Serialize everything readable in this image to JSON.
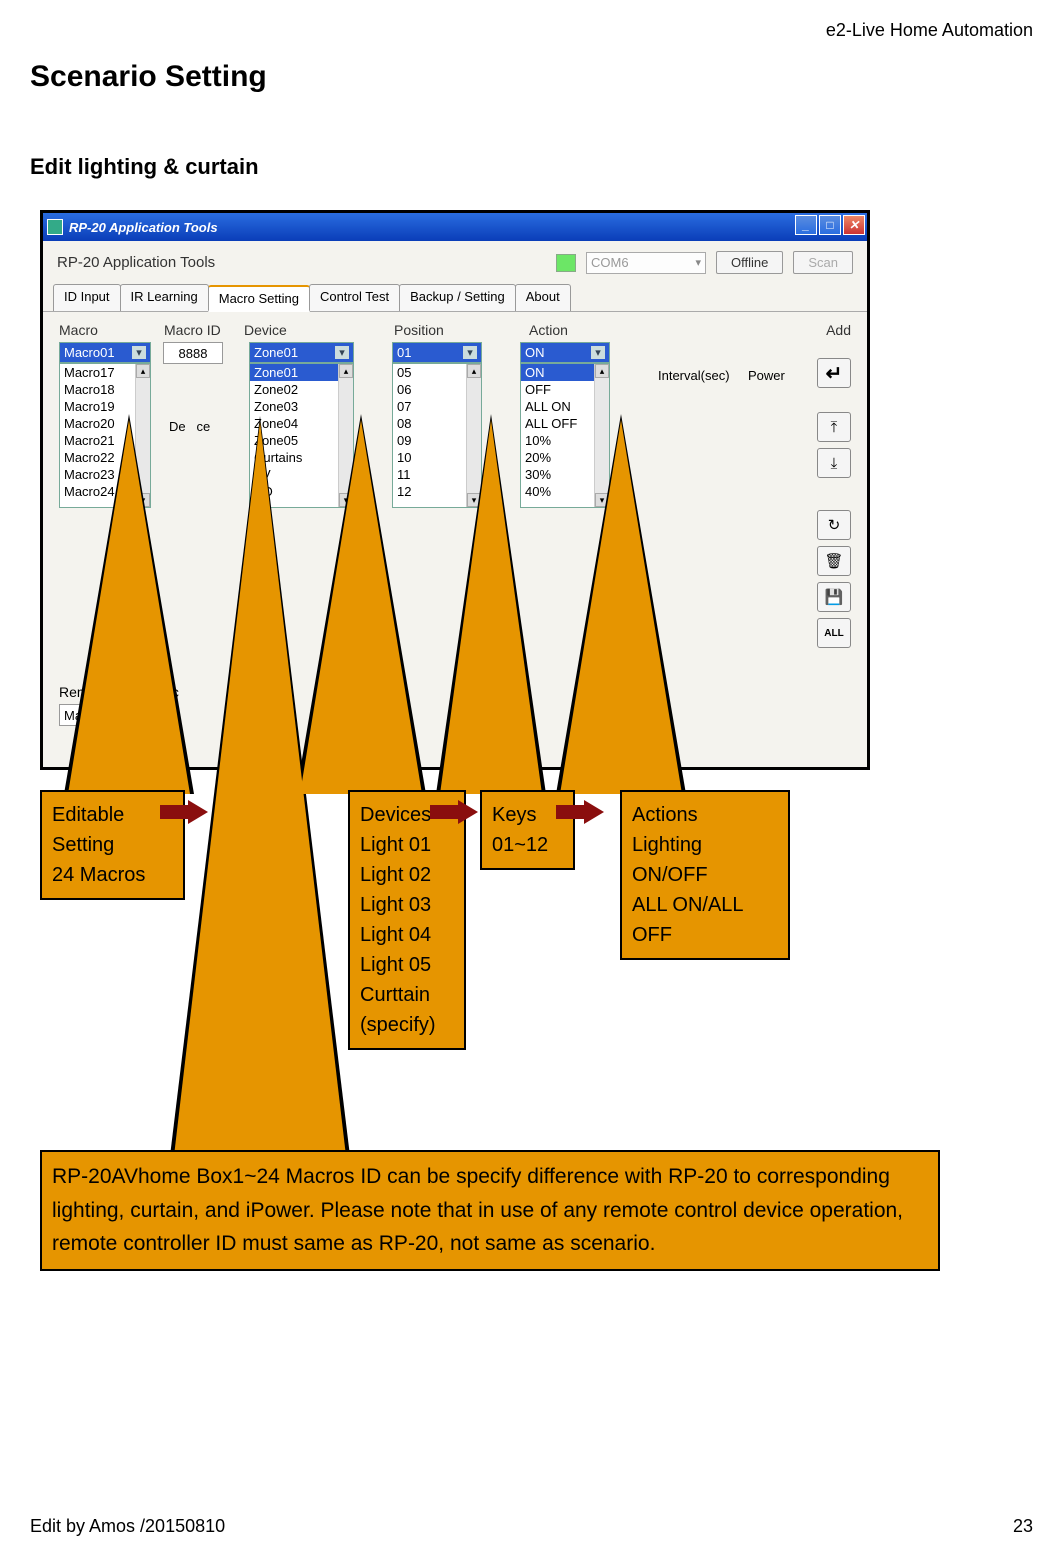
{
  "header": {
    "product": "e2-Live Home Automation"
  },
  "page": {
    "title": "Scenario Setting"
  },
  "section": {
    "title": "Edit lighting & curtain"
  },
  "window": {
    "title": "RP-20 Application Tools",
    "app_label": "RP-20 Application Tools",
    "com_port": "COM6",
    "offline_btn": "Offline",
    "scan_btn": "Scan",
    "tabs": [
      "ID Input",
      "IR Learning",
      "Macro Setting",
      "Control Test",
      "Backup / Setting",
      "About"
    ],
    "labels": {
      "macro": "Macro",
      "macro_id": "Macro ID",
      "device": "Device",
      "position": "Position",
      "action": "Action",
      "add": "Add"
    },
    "macro": {
      "selected": "Macro01",
      "id_value": "8888",
      "list": [
        "Macro17",
        "Macro18",
        "Macro19",
        "Macro20",
        "Macro21",
        "Macro22",
        "Macro23",
        "Macro24"
      ]
    },
    "device": {
      "selected": "Zone01",
      "list_sel": "Zone01",
      "list": [
        "Zone02",
        "Zone03",
        "Zone04",
        "Zone05",
        "Curtains",
        "TV",
        "CD"
      ]
    },
    "position": {
      "selected": "01",
      "list": [
        "05",
        "06",
        "07",
        "08",
        "09",
        "10",
        "11",
        "12"
      ]
    },
    "action": {
      "selected": "ON",
      "list_sel": "ON",
      "list": [
        "OFF",
        "ALL ON",
        "ALL OFF",
        "10%",
        "20%",
        "30%",
        "40%"
      ]
    },
    "grid_headers": {
      "device_col": "De",
      "device_col2": "ce",
      "interval": "Interval(sec)",
      "power": "Power"
    },
    "remove": {
      "label": "Remov",
      "single": "ingle Mac",
      "dd": "Macr"
    }
  },
  "callouts": {
    "macros": {
      "l1": "Editable",
      "l2": "Setting",
      "l3": "24 Macros"
    },
    "devices": {
      "l1": "Devices",
      "l2": "Light 01",
      "l3": "Light 02",
      "l4": "Light 03",
      "l5": "Light 04",
      "l6": "Light 05",
      "l7": "Curttain",
      "l8": "(specify)"
    },
    "keys": {
      "l1": "Keys",
      "l2": "01~12"
    },
    "actions": {
      "l1": "Actions",
      "l2": "Lighting",
      "l3": "ON/OFF",
      "l4": "ALL ON/ALL",
      "l5": "OFF"
    },
    "bottom": "RP-20AVhome Box1~24 Macros ID can be specify difference with RP-20 to corresponding lighting, curtain, and iPower. Please note that in use of any remote control device operation, remote controller ID must same as RP-20, not same as scenario."
  },
  "footer": {
    "left": "Edit by Amos /20150810",
    "right": "23"
  }
}
